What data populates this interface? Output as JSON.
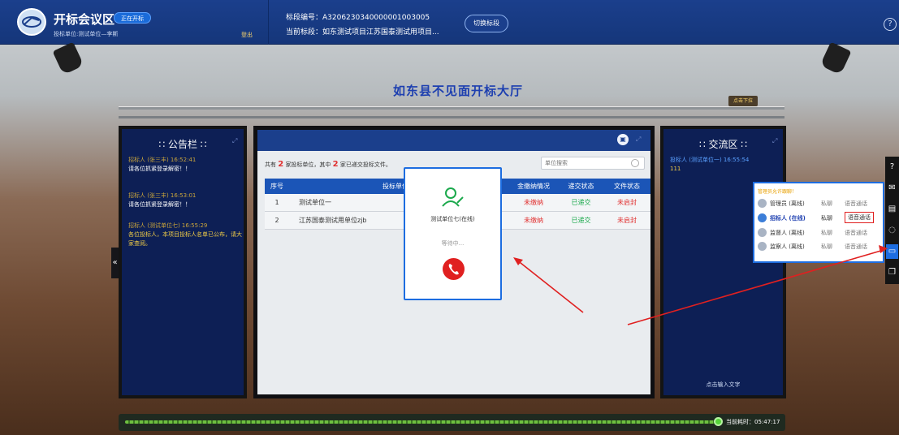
{
  "header": {
    "room_title": "开标会议区",
    "status_badge": "正在开标",
    "bidder_label": "投标单位:测试单位—李斯",
    "logout": "登出",
    "section_no": "标段编号：A3206230340000001003005",
    "current_section": "当前标段：如东测试项目江苏国泰测试用项目...",
    "switch_button": "切换标段",
    "help_icon": "question-icon"
  },
  "hall": {
    "title": "如东县不见面开标大厅",
    "pulldown": "点击下拉"
  },
  "notice_board": {
    "title": "∷ 公告栏 ∷",
    "items": [
      {
        "meta": "招标人 (张三丰) 16:52:41",
        "text": "请各位抓紧登录解密！！",
        "highlight": false
      },
      {
        "meta": "招标人 (张三丰) 16:53:01",
        "text": "请各位抓紧登录解密！！",
        "highlight": false
      },
      {
        "meta": "招标人 (测试单位七) 16:55:29",
        "text": "各位投标人，本项目投标人名单已公布，请大家查阅。",
        "highlight": true
      }
    ]
  },
  "chat": {
    "title": "∷ 交流区 ∷",
    "messages": [
      {
        "meta": "投标人 (测试单位一) 16:55:54",
        "text": "111"
      }
    ],
    "input_placeholder": "点击输入文字"
  },
  "board": {
    "count_prefix": "共有",
    "count_bidders": "2",
    "count_mid": "家投标单位，其中",
    "count_submitted": "2",
    "count_suffix": "家已递交投标文件。",
    "search_placeholder": "单位搜索",
    "columns": [
      "序号",
      "投标单位名",
      "金缴纳情况",
      "递交状态",
      "文件状态"
    ],
    "rows": [
      {
        "no": "1",
        "name": "测试单位一",
        "deposit": "未缴纳",
        "submit": "已递交",
        "file": "未启封"
      },
      {
        "no": "2",
        "name": "江苏国泰测试用单位zjb",
        "deposit": "未缴纳",
        "submit": "已递交",
        "file": "未启封"
      }
    ]
  },
  "call_dialog": {
    "callee": "测试单位七(在线)",
    "status": "等待中..."
  },
  "online_list": {
    "title": "管理员允许跟聊！",
    "entries": [
      {
        "role": "管理员 (离线)",
        "pm": "私聊",
        "voice": "语音通话"
      },
      {
        "role": "招标人 (在线)",
        "pm": "私聊",
        "voice": "语音通话"
      },
      {
        "role": "监督人 (离线)",
        "pm": "私聊",
        "voice": "语音通话"
      },
      {
        "role": "监察人 (离线)",
        "pm": "私聊",
        "voice": "语音通话"
      }
    ]
  },
  "progress": {
    "elapsed": "当前耗时：05:47:17",
    "fraction": 0.9
  },
  "colors": {
    "header_blue": "#1b3f8c",
    "table_head": "#1b55b7",
    "status_red": "#e13131",
    "status_green": "#1ba94c",
    "accent_blue": "#1d6de0"
  }
}
